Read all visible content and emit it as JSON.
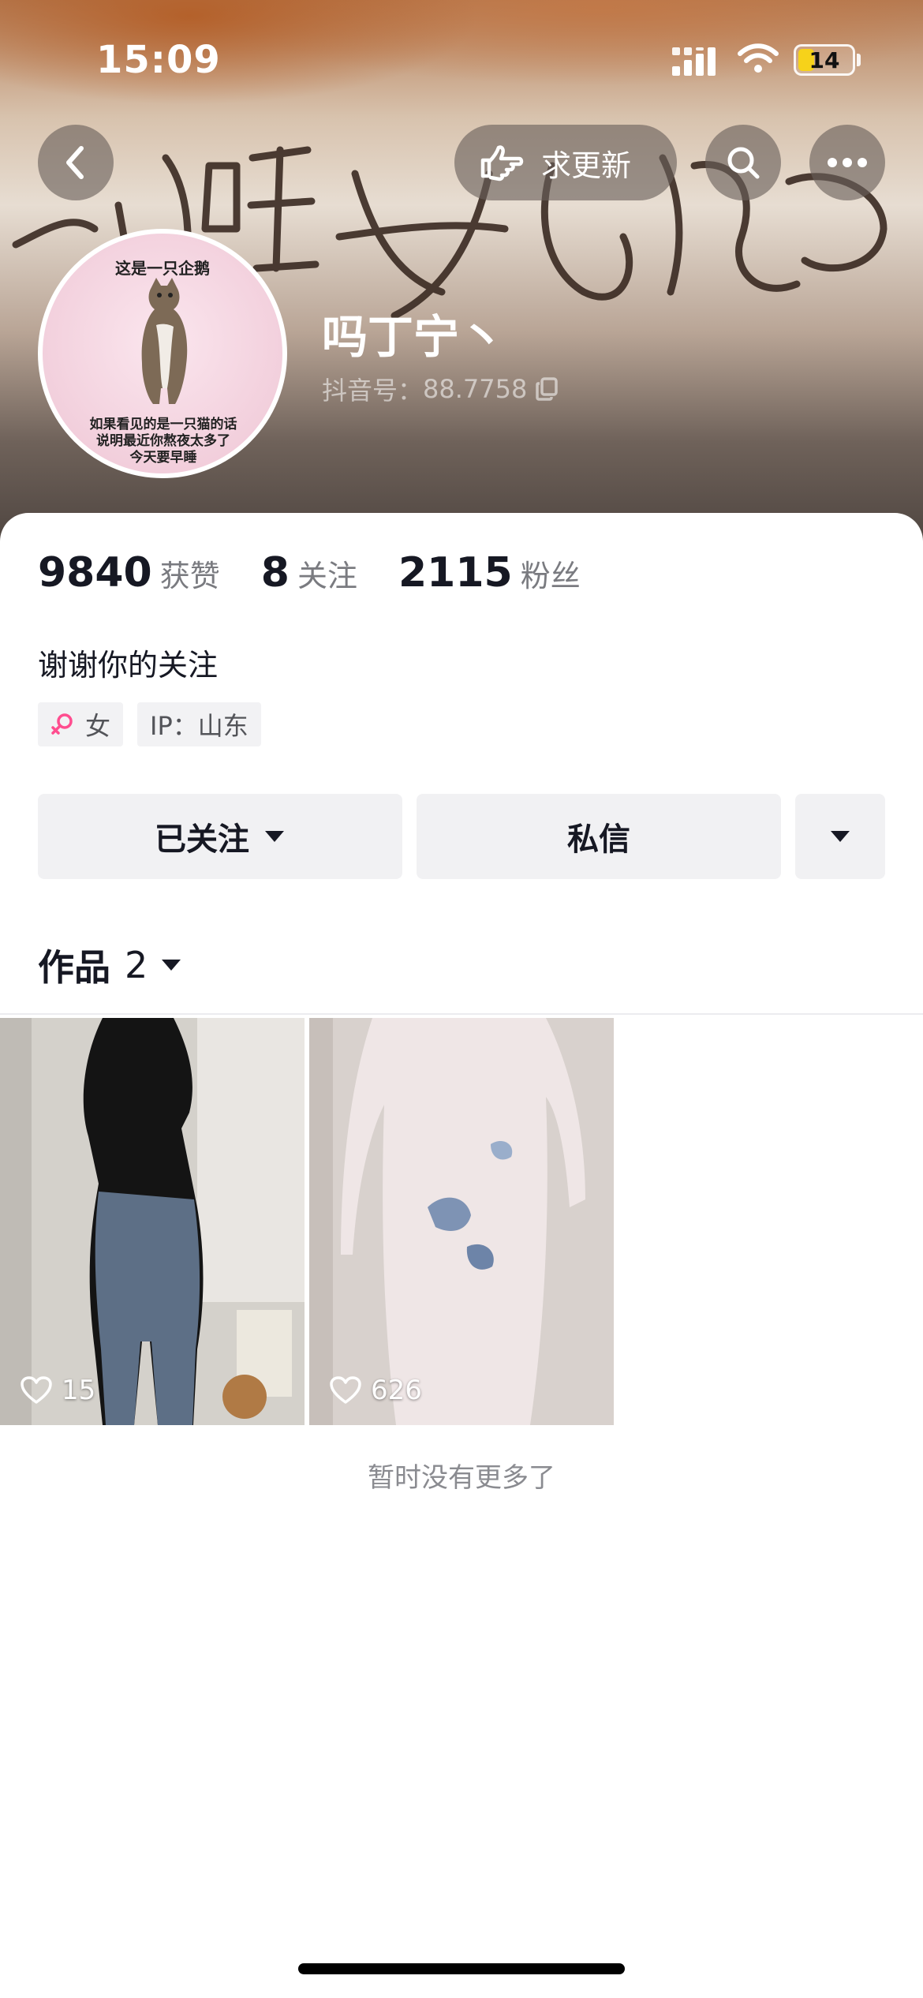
{
  "status_bar": {
    "time": "15:09",
    "battery": "14"
  },
  "header": {
    "update_label": "求更新",
    "icons": [
      "back-icon",
      "pointing-hand-icon",
      "search-icon",
      "more-icon"
    ]
  },
  "profile": {
    "avatar_text_top": "这是一只企鹅",
    "avatar_text_bottom_1": "如果看见的是一只猫的话",
    "avatar_text_bottom_2": "说明最近你熬夜太多了",
    "avatar_text_bottom_3": "今天要早睡",
    "nickname": "吗丁宁丶",
    "douyin_id_label": "抖音号：",
    "douyin_id_value": "88.7758"
  },
  "stats": [
    {
      "value": "9840",
      "label": "获赞"
    },
    {
      "value": "8",
      "label": "关注"
    },
    {
      "value": "2115",
      "label": "粉丝"
    }
  ],
  "bio": "谢谢你的关注",
  "tags": {
    "gender": "女",
    "ip": "IP：山东"
  },
  "actions": {
    "follow": "已关注",
    "message": "私信"
  },
  "works": {
    "label": "作品",
    "count": "2",
    "items": [
      {
        "likes": "15"
      },
      {
        "likes": "626"
      }
    ],
    "end_text": "暂时没有更多了"
  },
  "colors": {
    "accent_female": "#ff4d8f",
    "text_primary": "#161823",
    "text_secondary": "#7a7b80",
    "button_bg": "#f1f1f3"
  }
}
